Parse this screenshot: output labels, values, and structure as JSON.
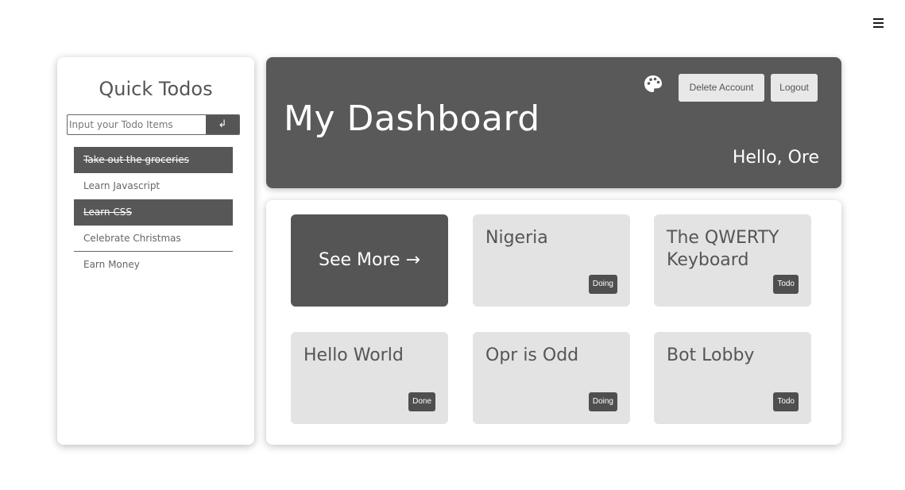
{
  "menu": {
    "icon": "hamburger-menu-icon"
  },
  "sidebar": {
    "title": "Quick Todos",
    "input_placeholder": "Input your Todo Items",
    "submit_glyph": "↲",
    "items": [
      {
        "label": "Take out the groceries",
        "done": true
      },
      {
        "label": "Learn Javascript",
        "done": false
      },
      {
        "label": "Learn CSS",
        "done": true
      },
      {
        "label": "Celebrate Christmas",
        "done": false
      },
      {
        "label": "Earn Money",
        "done": false
      }
    ]
  },
  "header": {
    "title": "My Dashboard",
    "greeting": "Hello, Ore",
    "palette_icon": "palette-icon",
    "delete_label": "Delete Account",
    "logout_label": "Logout"
  },
  "board": {
    "see_more": "See More →",
    "cards": [
      {
        "title": "Nigeria",
        "status": "Doing"
      },
      {
        "title": "The QWERTY Keyboard",
        "status": "Todo"
      },
      {
        "title": "Hello World",
        "status": "Done"
      },
      {
        "title": "Opr is Odd",
        "status": "Doing"
      },
      {
        "title": "Bot Lobby",
        "status": "Todo"
      }
    ]
  },
  "colors": {
    "header_bg": "#595959",
    "card_bg": "#e3e3e3",
    "badge_bg": "#4f4f4f",
    "done_item_bg": "#575757"
  }
}
